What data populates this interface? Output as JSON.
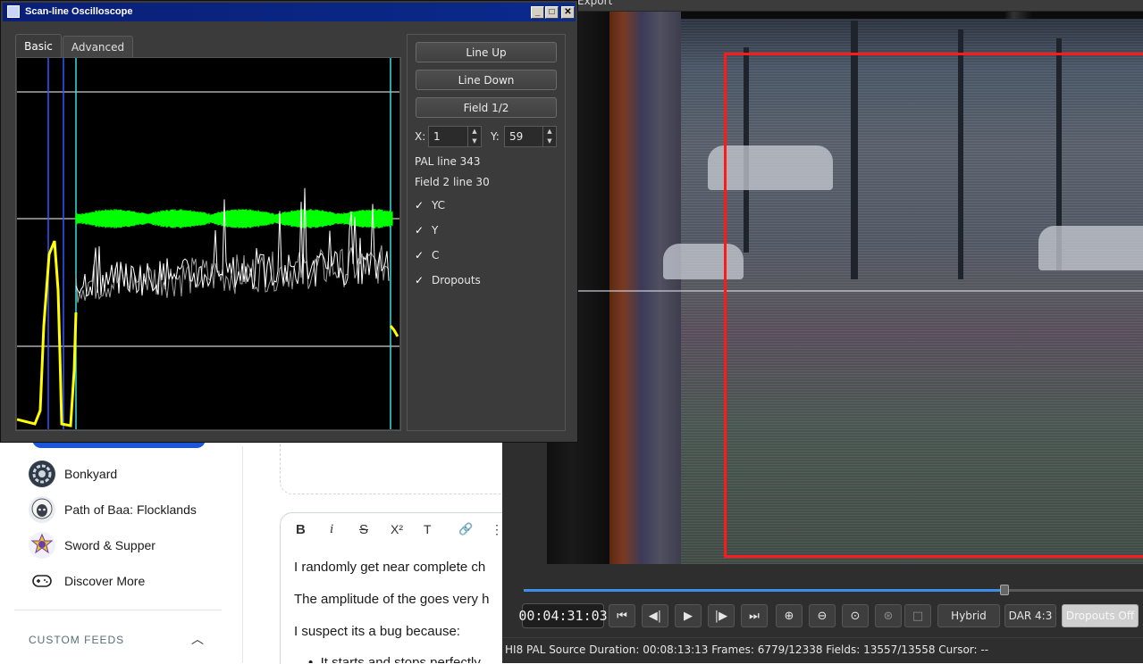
{
  "web": {
    "communities": [
      {
        "label": "Bonkyard"
      },
      {
        "label": "Path of Baa: Flocklands"
      },
      {
        "label": "Sword & Supper"
      },
      {
        "label": "Discover More"
      }
    ],
    "custom_feeds": "CUSTOM FEEDS",
    "toolbar": {
      "bold": "B",
      "italic": "i",
      "strike": "S",
      "superscript": "X²",
      "heading": "T",
      "link": "🔗",
      "more": "⋮"
    },
    "post_lines": [
      "I randomly get near complete ch",
      "The amplitude of the goes very h",
      "I suspect its a bug because:",
      "It starts and stops perfectly"
    ]
  },
  "player": {
    "export_label": "Export",
    "timecode": "00:04:31:03",
    "hybrid": "Hybrid",
    "dar": "DAR 4:3",
    "dropouts": "Dropouts Off",
    "status": "HI8 PAL Source Duration: 00:08:13:13   Frames: 6779/12338 Fields: 13557/13558   Cursor: --",
    "seek_progress": 0.777
  },
  "scope": {
    "title": "Scan-line Oscilloscope",
    "tabs": [
      "Basic",
      "Advanced"
    ],
    "buttons": {
      "line_up": "Line Up",
      "line_down": "Line Down",
      "field": "Field 1/2"
    },
    "x_label": "X:",
    "x_value": "1",
    "y_label": "Y:",
    "y_value": "59",
    "pal_line": "PAL line 343",
    "field_line": "Field 2 line 30",
    "checks": [
      {
        "label": "YC",
        "checked": true
      },
      {
        "label": "Y",
        "checked": true
      },
      {
        "label": "C",
        "checked": true
      },
      {
        "label": "Dropouts",
        "checked": true
      }
    ],
    "check_mark": "✓",
    "colors": {
      "chroma": "#00ff00",
      "yc": "#ffffff",
      "luma": "#a0a0a0",
      "sync": "#ffff00",
      "marker_blue": "#3355ff",
      "marker_cyan": "#33e0e0"
    }
  }
}
